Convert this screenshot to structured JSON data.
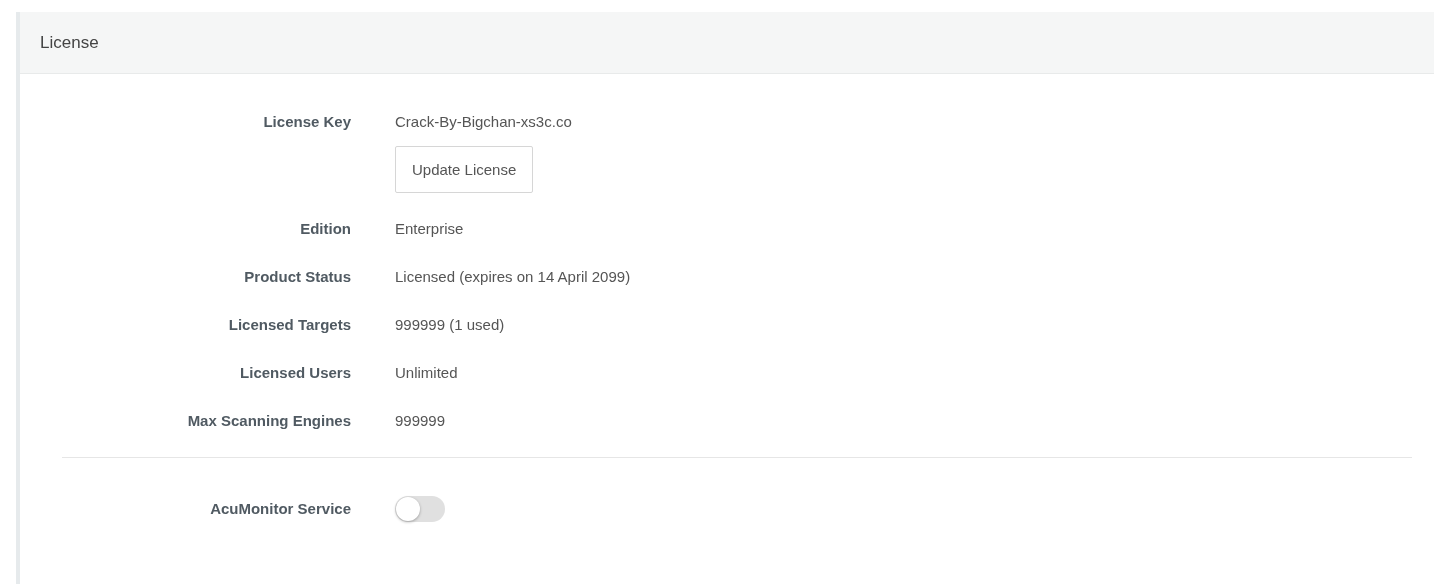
{
  "panel": {
    "title": "License"
  },
  "fields": [
    {
      "label": "License Key",
      "value": "Crack-By-Bigchan-xs3c.co",
      "button": "Update License"
    },
    {
      "label": "Edition",
      "value": "Enterprise"
    },
    {
      "label": "Product Status",
      "value": "Licensed (expires on 14 April 2099)"
    },
    {
      "label": "Licensed Targets",
      "value": "999999 (1 used)"
    },
    {
      "label": "Licensed Users",
      "value": "Unlimited"
    },
    {
      "label": "Max Scanning Engines",
      "value": "999999"
    }
  ],
  "service": {
    "label": "AcuMonitor Service",
    "on": false
  }
}
